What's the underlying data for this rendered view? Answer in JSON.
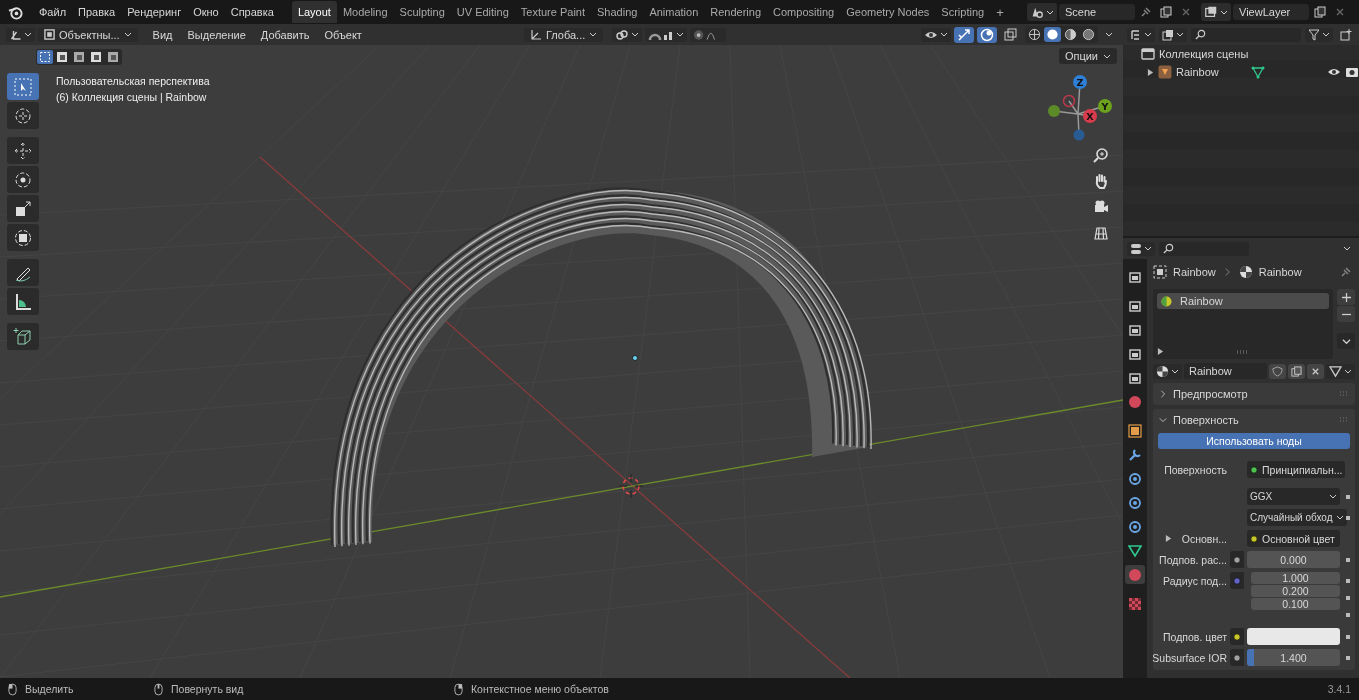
{
  "top_bar": {
    "menus": [
      "Файл",
      "Правка",
      "Рендеринг",
      "Окно",
      "Справка"
    ],
    "workspaces": [
      {
        "label": "Layout",
        "selected": true
      },
      {
        "label": "Modeling",
        "selected": false
      },
      {
        "label": "Sculpting",
        "selected": false
      },
      {
        "label": "UV Editing",
        "selected": false
      },
      {
        "label": "Texture Paint",
        "selected": false
      },
      {
        "label": "Shading",
        "selected": false
      },
      {
        "label": "Animation",
        "selected": false
      },
      {
        "label": "Rendering",
        "selected": false
      },
      {
        "label": "Compositing",
        "selected": false
      },
      {
        "label": "Geometry Nodes",
        "selected": false
      },
      {
        "label": "Scripting",
        "selected": false
      }
    ],
    "add_workspace": "+",
    "scene": "Scene",
    "view_layer": "ViewLayer"
  },
  "viewport": {
    "mode": "Объектны...",
    "menus": [
      "Вид",
      "Выделение",
      "Добавить",
      "Объект"
    ],
    "orientation": "Глоба...",
    "snap": {
      "on": false
    },
    "proportional_edit": {
      "on": false
    },
    "toggles": [
      {
        "kind": "gizmo",
        "on": true
      },
      {
        "kind": "overlay",
        "on": true
      }
    ],
    "shading_modes": [
      {
        "kind": "wireframe",
        "selected": false
      },
      {
        "kind": "solid",
        "selected": true
      },
      {
        "kind": "material",
        "selected": false
      },
      {
        "kind": "rendered",
        "selected": false
      }
    ],
    "select_modes": [
      {
        "selected": true
      },
      {
        "selected": false
      },
      {
        "selected": false
      },
      {
        "selected": false
      },
      {
        "selected": false
      }
    ],
    "overlay_text": [
      "Пользовательская перспектива",
      "(6) Коллекция сцены | Rainbow"
    ],
    "options": "Опции",
    "tools": [
      {
        "kind": "select",
        "selected": true
      },
      {
        "kind": "cursor",
        "selected": false
      },
      {
        "kind": "move",
        "selected": false
      },
      {
        "kind": "rotate",
        "selected": false
      },
      {
        "kind": "scale",
        "selected": false
      },
      {
        "kind": "transform",
        "selected": false
      },
      {
        "kind": "annotate",
        "selected": false
      },
      {
        "kind": "measure",
        "selected": false
      },
      {
        "kind": "add-cube",
        "selected": false
      }
    ],
    "gizmo": [
      {
        "label": "Z",
        "color": "#2f7fd6"
      },
      {
        "label": "Y",
        "color": "#6ca21c"
      },
      {
        "label": "X",
        "color": "#d83b4b"
      }
    ]
  },
  "outliner": {
    "collection": "Коллекция сцены",
    "objects": [
      {
        "label": "Rainbow",
        "expanded": false
      }
    ]
  },
  "properties": {
    "tabs": [
      {
        "kind": "tool",
        "selected": false
      },
      {
        "kind": "render",
        "selected": false
      },
      {
        "kind": "output",
        "selected": false
      },
      {
        "kind": "view-layer",
        "selected": false
      },
      {
        "kind": "scene",
        "selected": false
      },
      {
        "kind": "world",
        "selected": false
      },
      {
        "kind": "object",
        "selected": false
      },
      {
        "kind": "modifiers",
        "selected": false
      },
      {
        "kind": "particles",
        "selected": false
      },
      {
        "kind": "physics",
        "selected": false
      },
      {
        "kind": "constraints",
        "selected": false
      },
      {
        "kind": "data",
        "selected": false
      },
      {
        "kind": "material",
        "selected": true
      },
      {
        "kind": "texture",
        "selected": false
      }
    ],
    "breadcrumb": [
      "Rainbow",
      "Rainbow"
    ],
    "slots": [
      {
        "label": "Rainbow",
        "selected": true
      }
    ],
    "material": "Rainbow",
    "panels": [
      {
        "label": "Предпросмотр",
        "expanded": false
      },
      {
        "label": "Поверхность",
        "expanded": true
      }
    ],
    "use_nodes": "Использовать ноды",
    "fields": [
      {
        "kind": "link",
        "label": "Поверхность",
        "color": "#4fc14f",
        "value": "Принципиальн..."
      },
      {
        "kind": "dropdown",
        "value": "GGX"
      },
      {
        "kind": "dropdown",
        "value": "Случайный обход"
      },
      {
        "kind": "link",
        "label": "Основн...",
        "color": "#c7c729",
        "value": "Основной цвет",
        "expandable": true
      },
      {
        "kind": "number",
        "label": "Подпов. рас...",
        "color": "#a1a1a1",
        "value": "0.000"
      },
      {
        "kind": "vector",
        "label": "Радиус под...",
        "color": "#6363c7",
        "values": [
          "1.000",
          "0.200",
          "0.100"
        ]
      },
      {
        "kind": "color",
        "label": "Подпов. цвет",
        "color": "#c7c729"
      },
      {
        "kind": "slider",
        "label": "Subsurface IOR",
        "color": "#a1a1a1",
        "value": "1.400",
        "level": 0.08
      }
    ]
  },
  "status_bar": {
    "hints": [
      "Выделить",
      "Повернуть вид",
      "Контекстное меню объектов"
    ],
    "version": "3.4.1"
  }
}
